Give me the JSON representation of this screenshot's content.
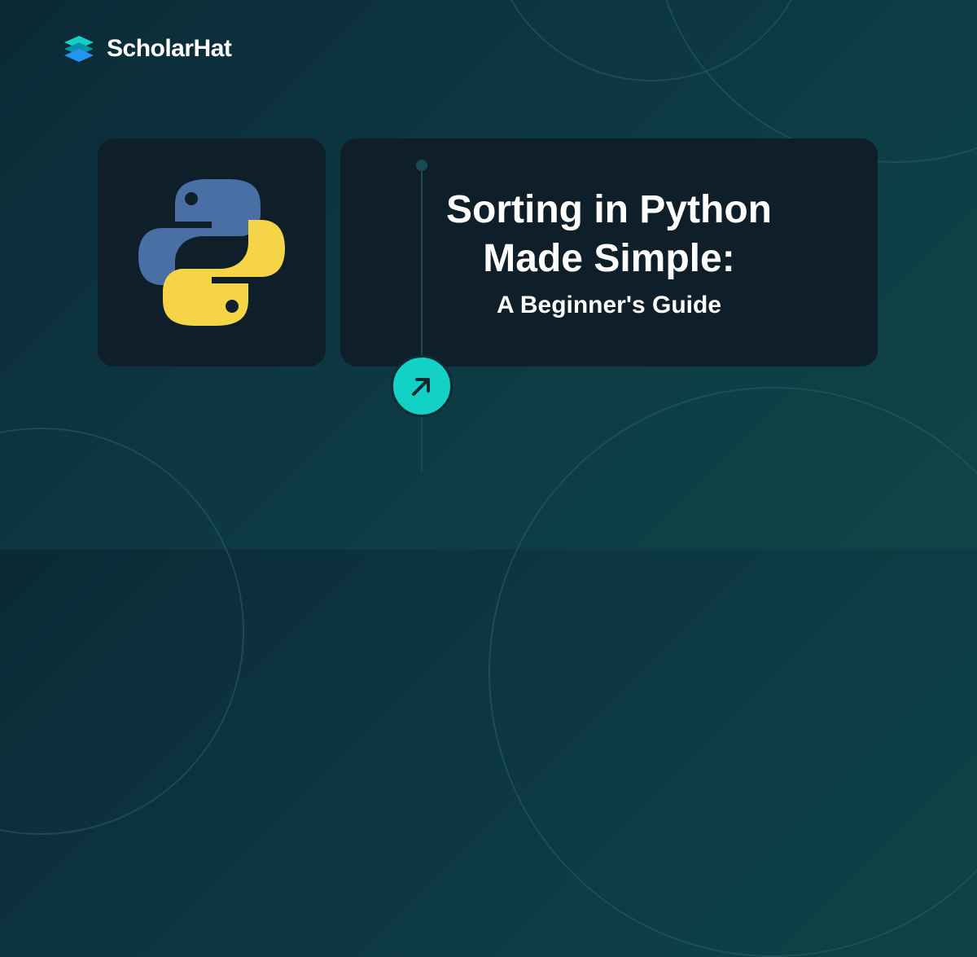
{
  "brand": {
    "name": "ScholarHat"
  },
  "content": {
    "title_line1": "Sorting in Python",
    "title_line2": "Made Simple:",
    "subtitle": "A Beginner's Guide"
  },
  "colors": {
    "background_start": "#0a2a35",
    "background_end": "#0f4548",
    "card_bg": "#0f1f2a",
    "accent": "#14d1c5",
    "logo_teal": "#14d1c5",
    "logo_blue": "#2196f3"
  }
}
